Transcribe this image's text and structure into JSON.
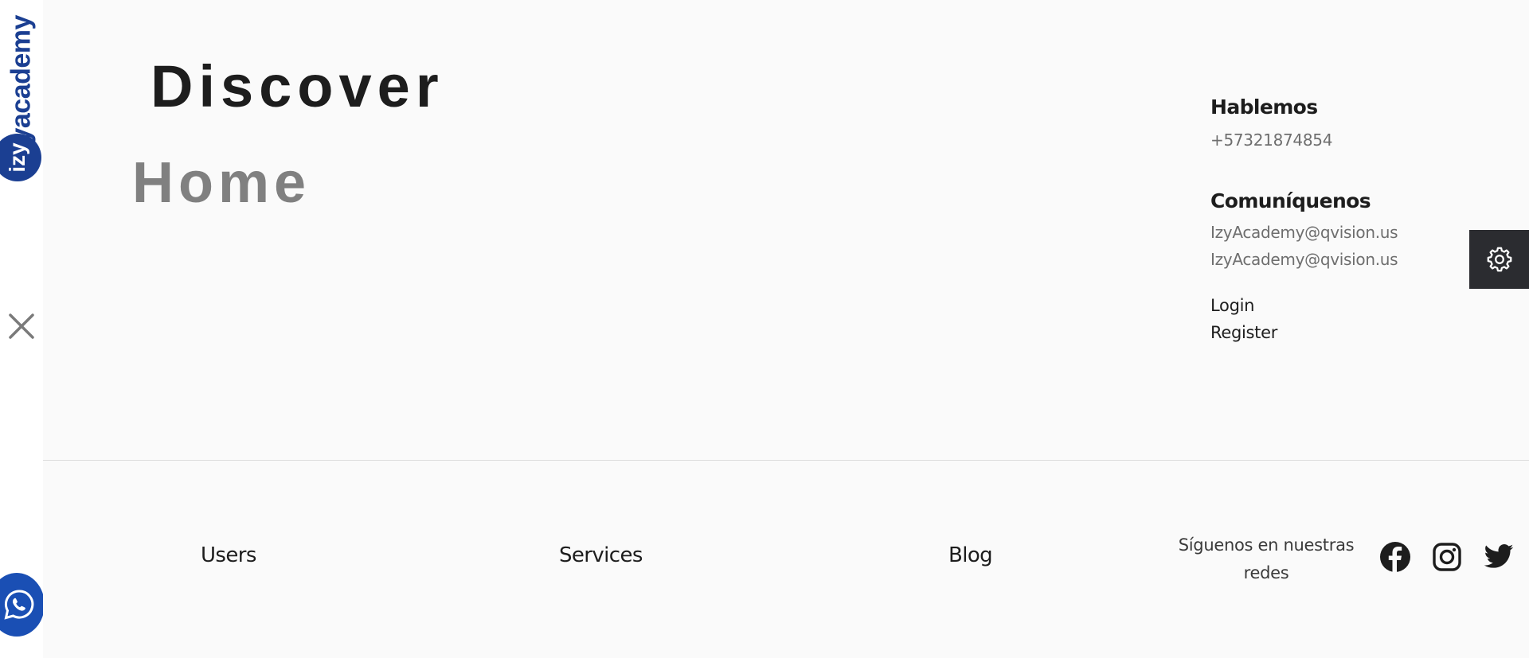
{
  "brand": {
    "logo_text": "izyacademy",
    "logo_mark": "izy",
    "accent_color": "#1b3f92"
  },
  "hero": {
    "line1": "Discover",
    "line2": "Home"
  },
  "contact": {
    "talk_heading": "Hablemos",
    "phone": "+57321874854",
    "write_heading": "Comuníquenos",
    "email_1": "IzyAcademy@qvision.us",
    "email_2": "IzyAcademy@qvision.us",
    "login_label": "Login",
    "register_label": "Register"
  },
  "footer": {
    "links": [
      "Users",
      "Services",
      "Blog"
    ],
    "follow_text": "Síguenos en nuestras redes",
    "social": [
      "facebook-icon",
      "instagram-icon",
      "twitter-icon"
    ]
  },
  "icons": {
    "close": "close-icon",
    "whatsapp": "whatsapp-icon",
    "settings": "gear-icon"
  },
  "colors": {
    "page_bg": "#fafafa",
    "sidebar_bg": "#ffffff",
    "whatsapp_bg": "#1a4fb4",
    "settings_bg": "#2b2c30"
  }
}
